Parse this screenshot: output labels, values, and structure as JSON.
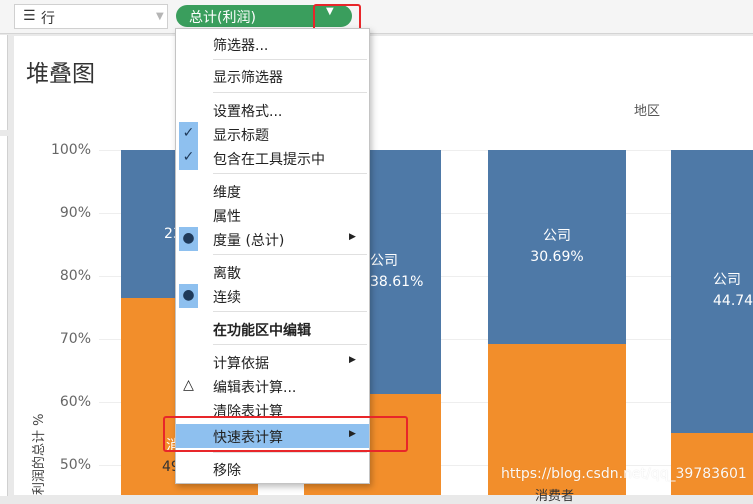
{
  "shelf": {
    "label": "行",
    "icon": "rows-icon",
    "pill": "总计(利润)"
  },
  "sheet_title": "堆叠图",
  "column_header": "地区",
  "y_axis": {
    "title": "利润的总计 %",
    "ticks": [
      "100%",
      "90%",
      "80%",
      "70%",
      "60%",
      "50%"
    ]
  },
  "bars": [
    {
      "company_label": "公司",
      "company_value": "23",
      "consumer_label": "消",
      "consumer_value": "49"
    },
    {
      "company_label": "公司",
      "company_value": "38.61%",
      "consumer_label": "",
      "consumer_value": ""
    },
    {
      "company_label": "公司",
      "company_value": "30.69%",
      "consumer_label": "",
      "consumer_value": ""
    },
    {
      "company_label": "公司",
      "company_value": "44.74",
      "consumer_label": "",
      "consumer_value": ""
    }
  ],
  "category_bottom": "消费者",
  "watermark": "https://blog.csdn.net/qq_39783601",
  "colors": {
    "pill": "#3a9e5d",
    "company": "#4e79a7",
    "consumer": "#f28e2b",
    "highlight": "#8ec0ef",
    "annotation": "#e8262a"
  },
  "menu": {
    "filter": "筛选器...",
    "show_filter": "显示筛选器",
    "format": "设置格式...",
    "show_header": "显示标题",
    "include_tooltip": "包含在工具提示中",
    "dimension": "维度",
    "attribute": "属性",
    "measure": "度量 (总计)",
    "discrete": "离散",
    "continuous": "连续",
    "edit_in_shelf": "在功能区中编辑",
    "compute_using": "计算依据",
    "edit_table_calc": "编辑表计算...",
    "clear_table_calc": "清除表计算",
    "quick_table_calc": "快速表计算",
    "remove": "移除"
  },
  "glyphs": {
    "check": "✓",
    "dot": "●",
    "delta": "△",
    "submenu": "▶",
    "down": "▼"
  }
}
